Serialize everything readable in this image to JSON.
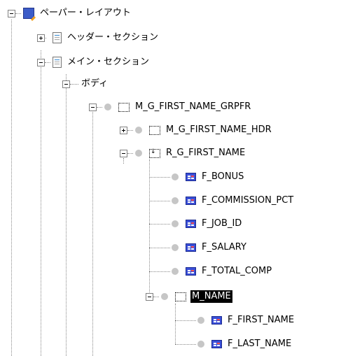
{
  "tree": {
    "root_label": "ペーパー・レイアウト",
    "header_section_label": "ヘッダー・セクション",
    "main_section_label": "メイン・セクション",
    "body_label": "ボディ",
    "group_frame_label": "M_G_FIRST_NAME_GRPFR",
    "header_frame_label": "M_G_FIRST_NAME_HDR",
    "repeating_frame_label": "R_G_FIRST_NAME",
    "fields": [
      {
        "label": "F_BONUS"
      },
      {
        "label": "F_COMMISSION_PCT"
      },
      {
        "label": "F_JOB_ID"
      },
      {
        "label": "F_SALARY"
      },
      {
        "label": "F_TOTAL_COMP"
      }
    ],
    "name_frame_label": "M_NAME",
    "name_fields": [
      {
        "label": "F_FIRST_NAME"
      },
      {
        "label": "F_LAST_NAME"
      }
    ],
    "selected": "M_NAME"
  }
}
